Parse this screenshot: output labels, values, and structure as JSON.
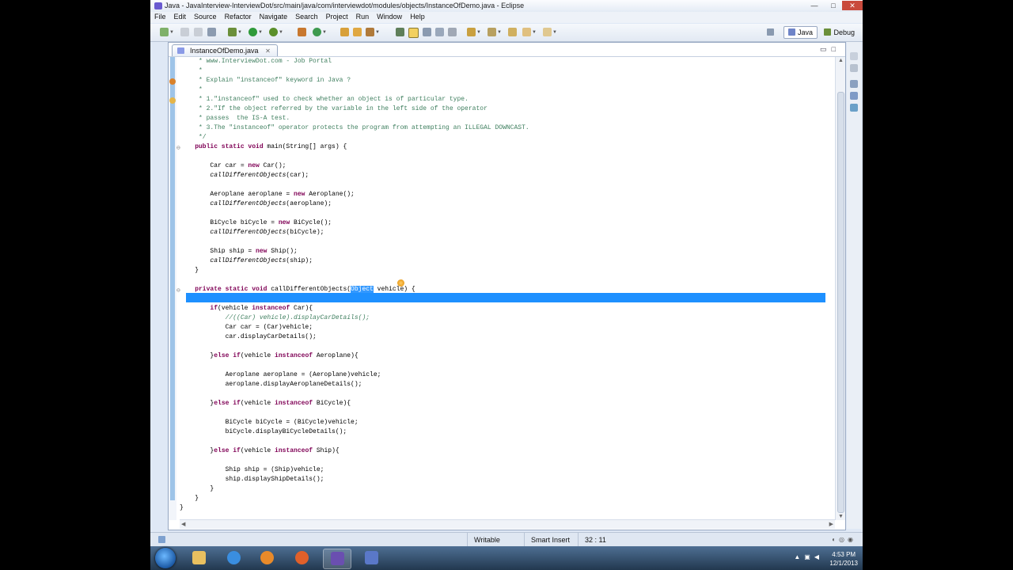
{
  "window": {
    "title": "Java - JavaInterview-InterviewDot/src/main/java/com/interviewdot/modules/objects/InstanceOfDemo.java - Eclipse",
    "controls": [
      "—",
      "□",
      "✕"
    ]
  },
  "menu": [
    "File",
    "Edit",
    "Source",
    "Refactor",
    "Navigate",
    "Search",
    "Project",
    "Run",
    "Window",
    "Help"
  ],
  "perspectives": {
    "java": "Java",
    "debug": "Debug"
  },
  "editor": {
    "tab_label": "InstanceOfDemo.java",
    "code_lines": [
      [
        {
          "t": "     * www.InterviewDot.com - Job Portal",
          "c": "cm"
        }
      ],
      [
        {
          "t": "     *",
          "c": "cm"
        }
      ],
      [
        {
          "t": "     * Explain \"instanceof\" keyword in Java ?",
          "c": "cm"
        }
      ],
      [
        {
          "t": "     *",
          "c": "cm"
        }
      ],
      [
        {
          "t": "     * 1.\"instanceof\" used to check whether an object is of particular type.",
          "c": "cm"
        }
      ],
      [
        {
          "t": "     * 2.\"If the object referred by the variable in the left side of the operator",
          "c": "cm"
        }
      ],
      [
        {
          "t": "     * passes  the IS-A test.",
          "c": "cm"
        }
      ],
      [
        {
          "t": "     * 3.The \"instanceof\" operator protects the program from attempting an ILLEGAL DOWNCAST.",
          "c": "cm"
        }
      ],
      [
        {
          "t": "     */",
          "c": "cm"
        }
      ],
      [
        {
          "t": "    "
        },
        {
          "t": "public static void",
          "c": "kw"
        },
        {
          "t": " main(String[] args) {"
        }
      ],
      [],
      [
        {
          "t": "        Car car = "
        },
        {
          "t": "new",
          "c": "kw"
        },
        {
          "t": " Car();"
        }
      ],
      [
        {
          "t": "        "
        },
        {
          "t": "callDifferentObjects",
          "c": "fn"
        },
        {
          "t": "(car);"
        }
      ],
      [],
      [
        {
          "t": "        Aeroplane aeroplane = "
        },
        {
          "t": "new",
          "c": "kw"
        },
        {
          "t": " Aeroplane();"
        }
      ],
      [
        {
          "t": "        "
        },
        {
          "t": "callDifferentObjects",
          "c": "fn"
        },
        {
          "t": "(aeroplane);"
        }
      ],
      [],
      [
        {
          "t": "        BiCycle biCycle = "
        },
        {
          "t": "new",
          "c": "kw"
        },
        {
          "t": " BiCycle();"
        }
      ],
      [
        {
          "t": "        "
        },
        {
          "t": "callDifferentObjects",
          "c": "fn"
        },
        {
          "t": "(biCycle);"
        }
      ],
      [],
      [
        {
          "t": "        Ship ship = "
        },
        {
          "t": "new",
          "c": "kw"
        },
        {
          "t": " Ship();"
        }
      ],
      [
        {
          "t": "        "
        },
        {
          "t": "callDifferentObjects",
          "c": "fn"
        },
        {
          "t": "(ship);"
        }
      ],
      [
        {
          "t": "    }"
        }
      ],
      [],
      [
        {
          "t": "    "
        },
        {
          "t": "private static void",
          "c": "kw"
        },
        {
          "t": " callDifferentObjects("
        },
        {
          "t": "Object",
          "c": "sel"
        },
        {
          "t": " vehicle) {"
        }
      ],
      [],
      [
        {
          "t": "        "
        },
        {
          "t": "if",
          "c": "kw"
        },
        {
          "t": "(vehicle "
        },
        {
          "t": "instanceof",
          "c": "kw"
        },
        {
          "t": " Car){"
        }
      ],
      [
        {
          "t": "            //((Car) vehicle).displayCarDetails();",
          "c": "cmi"
        }
      ],
      [
        {
          "t": "            Car car = (Car)vehicle;"
        }
      ],
      [
        {
          "t": "            car.displayCarDetails();"
        }
      ],
      [],
      [
        {
          "t": "        }"
        },
        {
          "t": "else if",
          "c": "kw"
        },
        {
          "t": "(vehicle "
        },
        {
          "t": "instanceof",
          "c": "kw"
        },
        {
          "t": " Aeroplane){"
        }
      ],
      [],
      [
        {
          "t": "            Aeroplane aeroplane = (Aeroplane)vehicle;"
        }
      ],
      [
        {
          "t": "            aeroplane.displayAeroplaneDetails();"
        }
      ],
      [],
      [
        {
          "t": "        }"
        },
        {
          "t": "else if",
          "c": "kw"
        },
        {
          "t": "(vehicle "
        },
        {
          "t": "instanceof",
          "c": "kw"
        },
        {
          "t": " BiCycle){"
        }
      ],
      [],
      [
        {
          "t": "            BiCycle biCycle = (BiCycle)vehicle;"
        }
      ],
      [
        {
          "t": "            biCycle.displayBiCycleDetails();"
        }
      ],
      [],
      [
        {
          "t": "        }"
        },
        {
          "t": "else if",
          "c": "kw"
        },
        {
          "t": "(vehicle "
        },
        {
          "t": "instanceof",
          "c": "kw"
        },
        {
          "t": " Ship){"
        }
      ],
      [],
      [
        {
          "t": "            Ship ship = (Ship)vehicle;"
        }
      ],
      [
        {
          "t": "            ship.displayShipDetails();"
        }
      ],
      [
        {
          "t": "        }"
        }
      ],
      [
        {
          "t": "    }"
        }
      ],
      [
        {
          "t": "}"
        }
      ]
    ]
  },
  "status": {
    "writable": "Writable",
    "insert_mode": "Smart Insert",
    "position": "32 : 11"
  },
  "taskbar": {
    "time": "4:53 PM",
    "date": "12/1/2013"
  }
}
